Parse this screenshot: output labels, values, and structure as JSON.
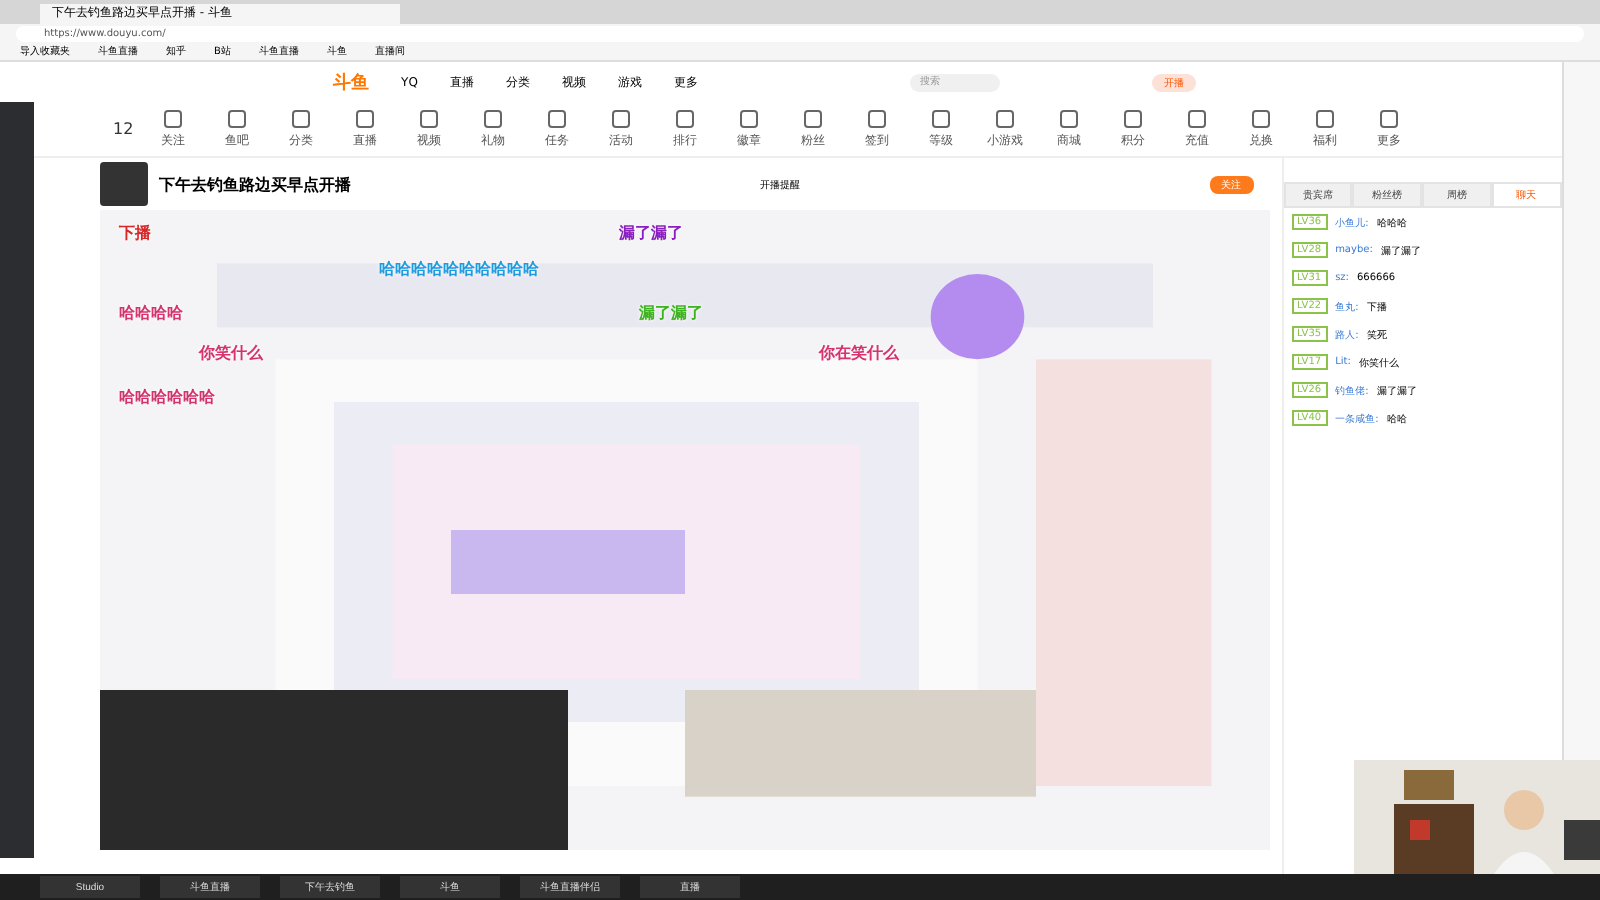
{
  "browser": {
    "tab_title": "下午去钓鱼路边买早点开播 - 斗鱼",
    "url": "https://www.douyu.com/",
    "bookmarks": [
      "导入收藏夹",
      "斗鱼直播",
      "知乎",
      "B站",
      "斗鱼直播",
      "斗鱼",
      "直播间"
    ]
  },
  "site": {
    "logo": "斗鱼",
    "nav": [
      "YQ",
      "直播",
      "分类",
      "视频",
      "游戏",
      "更多"
    ],
    "search_placeholder": "搜索",
    "open_button": "开播",
    "follow_count": "12"
  },
  "tools": [
    "关注",
    "鱼吧",
    "分类",
    "直播",
    "视频",
    "礼物",
    "任务",
    "活动",
    "排行",
    "徽章",
    "粉丝",
    "签到",
    "等级",
    "小游戏",
    "商城",
    "积分",
    "充值",
    "兑换",
    "福利",
    "更多"
  ],
  "room": {
    "title": "下午去钓鱼路边买早点开播",
    "follow": "关注",
    "report": "开播提醒"
  },
  "danmaku": [
    {
      "text": "下播",
      "color": "#d62828"
    },
    {
      "text": "漏了漏了",
      "color": "#8a1fbf"
    },
    {
      "text": "哈哈哈哈哈哈哈哈哈哈",
      "color": "#1f9be0"
    },
    {
      "text": "哈哈哈哈",
      "color": "#d6336c"
    },
    {
      "text": "漏了漏了",
      "color": "#3fb21f"
    },
    {
      "text": "你笑什么",
      "color": "#d6336c"
    },
    {
      "text": "你在笑什么",
      "color": "#d6336c"
    },
    {
      "text": "哈哈哈哈哈哈",
      "color": "#d6336c"
    }
  ],
  "chat": {
    "tabs": [
      {
        "label": "贵宾席",
        "selected": false
      },
      {
        "label": "粉丝榜",
        "selected": false
      },
      {
        "label": "周榜",
        "selected": false
      },
      {
        "label": "聊天",
        "selected": true
      }
    ],
    "messages": [
      {
        "level": "LV36",
        "user": "小鱼儿:",
        "text": "哈哈哈"
      },
      {
        "level": "LV28",
        "user": "maybe:",
        "text": "漏了漏了"
      },
      {
        "level": "LV31",
        "user": "sz:",
        "text": "666666"
      },
      {
        "level": "LV22",
        "user": "鱼丸:",
        "text": "下播"
      },
      {
        "level": "LV35",
        "user": "路人:",
        "text": "笑死"
      },
      {
        "level": "LV17",
        "user": "Lit:",
        "text": "你笑什么"
      },
      {
        "level": "LV26",
        "user": "钓鱼佬:",
        "text": "漏了漏了"
      },
      {
        "level": "LV40",
        "user": "一条咸鱼:",
        "text": "哈哈"
      }
    ]
  },
  "taskbar": [
    "Studio",
    "斗鱼直播",
    "下午去钓鱼",
    "斗鱼",
    "斗鱼直播伴侣",
    "直播"
  ]
}
